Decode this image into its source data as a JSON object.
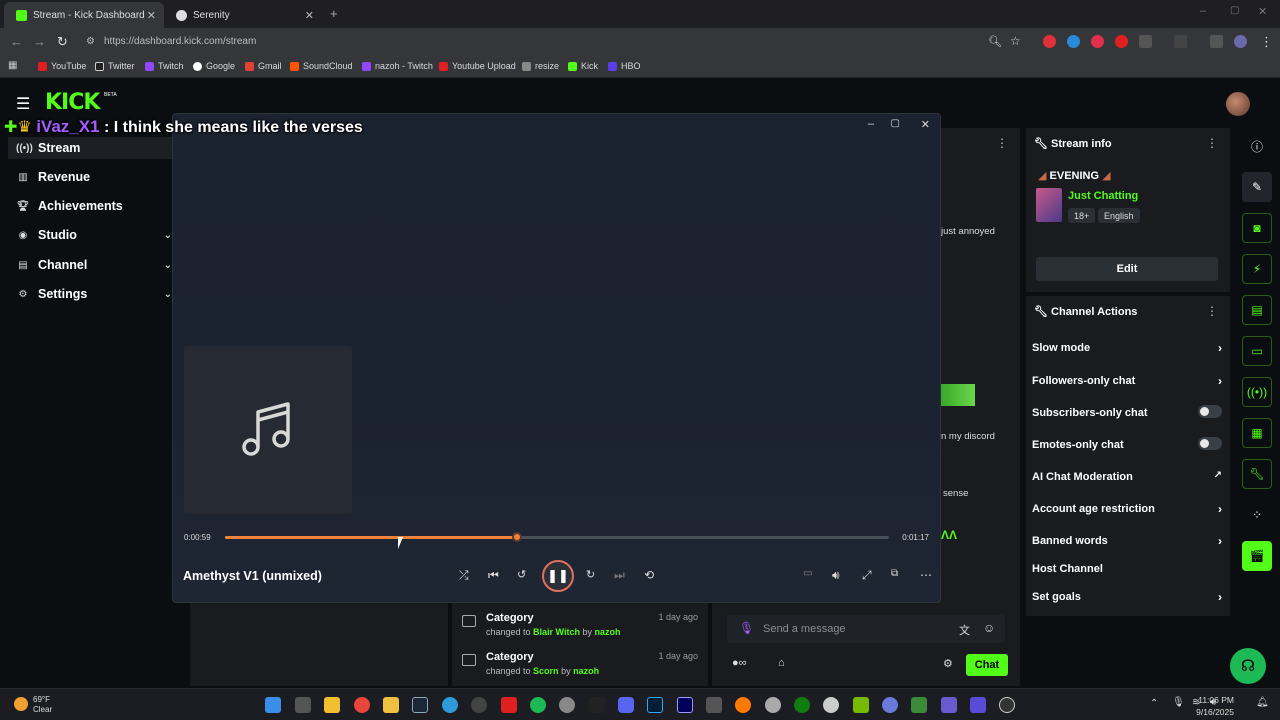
{
  "browser": {
    "tabs": [
      {
        "title": "Stream - Kick Dashboard",
        "active": true
      },
      {
        "title": "Serenity",
        "active": false
      }
    ],
    "url": "https://dashboard.kick.com/stream",
    "bookmarks": [
      "YouTube",
      "Twitter",
      "Twitch",
      "Google",
      "Gmail",
      "SoundCloud",
      "nazoh - Twitch",
      "Youtube Upload",
      "resize",
      "Kick",
      "HBO"
    ]
  },
  "kick": {
    "logo": "KICK",
    "beta": "BETA",
    "sidebar": [
      {
        "label": "Stream",
        "icon": "broadcast-icon",
        "expand": false
      },
      {
        "label": "Revenue",
        "icon": "chart-icon",
        "expand": false
      },
      {
        "label": "Achievements",
        "icon": "trophy-icon",
        "expand": false
      },
      {
        "label": "Studio",
        "icon": "studio-icon",
        "expand": true
      },
      {
        "label": "Channel",
        "icon": "channel-icon",
        "expand": true
      },
      {
        "label": "Settings",
        "icon": "gear-icon",
        "expand": true
      }
    ],
    "stream_info": {
      "header": "Stream info",
      "title": "EVENING",
      "category": "Just Chatting",
      "tags": [
        "18+",
        "English"
      ],
      "edit": "Edit"
    },
    "channel_actions": {
      "header": "Channel Actions",
      "items": [
        {
          "label": "Slow mode",
          "control": "arrow"
        },
        {
          "label": "Followers-only chat",
          "control": "arrow"
        },
        {
          "label": "Subscribers-only chat",
          "control": "toggle"
        },
        {
          "label": "Emotes-only chat",
          "control": "toggle"
        },
        {
          "label": "AI Chat Moderation",
          "control": "external"
        },
        {
          "label": "Account age restriction",
          "control": "arrow"
        },
        {
          "label": "Banned words",
          "control": "arrow"
        },
        {
          "label": "Host Channel",
          "control": "none"
        },
        {
          "label": "Set goals",
          "control": "arrow"
        }
      ]
    },
    "chat_fragments": [
      "just annoyed",
      "n my discord",
      "sense"
    ],
    "events": [
      {
        "title": "Category",
        "prefix": "changed to ",
        "target": "Blair Witch",
        "by": " by ",
        "user": "nazoh",
        "ago": "1 day ago"
      },
      {
        "title": "Category",
        "prefix": "changed to ",
        "target": "Scorn",
        "by": " by ",
        "user": "nazoh",
        "ago": "1 day ago"
      }
    ],
    "chat_input_placeholder": "Send a message",
    "chat_button": "Chat"
  },
  "overlay_chat": {
    "user": "iVaz_X1",
    "sep": " : ",
    "message": "I think she means like the verses"
  },
  "player": {
    "song": "Amethyst V1 (unmixed)",
    "elapsed": "0:00:59",
    "total": "0:01:17",
    "progress": 0.44
  },
  "taskbar": {
    "temp": "69°F",
    "condition": "Clear",
    "time": "11:06 PM",
    "date": "9/16/2025"
  },
  "colors": {
    "kick_green": "#53fc18",
    "player_accent": "#f5823a",
    "username": "#a45cff"
  }
}
